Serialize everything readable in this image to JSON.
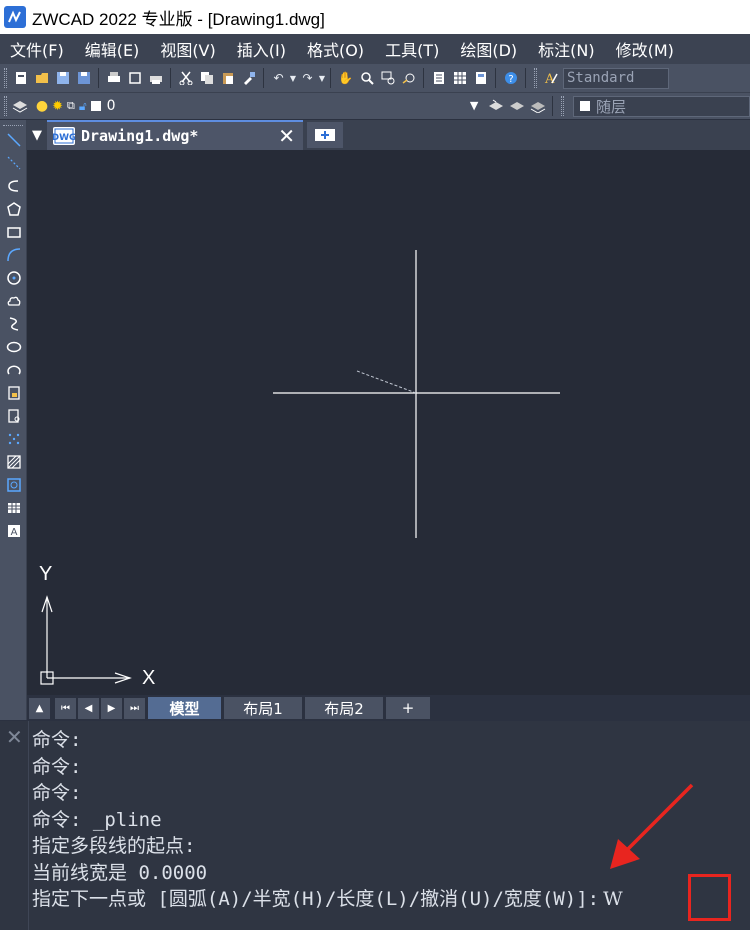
{
  "window": {
    "title": "ZWCAD 2022 专业版 - [Drawing1.dwg]"
  },
  "menu": [
    "文件(F)",
    "编辑(E)",
    "视图(V)",
    "插入(I)",
    "格式(O)",
    "工具(T)",
    "绘图(D)",
    "标注(N)",
    "修改(M)"
  ],
  "toolbar1": {
    "text_style": "Standard"
  },
  "toolbar2": {
    "layer": "0",
    "color": "随层"
  },
  "doc_tabs": {
    "active": "Drawing1.dwg*"
  },
  "layout_tabs": [
    "模型",
    "布局1",
    "布局2",
    "+"
  ],
  "canvas": {
    "axis_x": "X",
    "axis_y": "Y"
  },
  "command": {
    "history": [
      "命令:",
      "命令:",
      "命令:",
      "命令: _pline",
      "指定多段线的起点:",
      "当前线宽是 0.0000"
    ],
    "prompt": "指定下一点或 [圆弧(A)/半宽(H)/长度(L)/撤消(U)/宽度(W)]:",
    "input": "W"
  },
  "colors": {
    "menubar": "#3c4352",
    "toolbar": "#4a5263",
    "canvas": "#262b37",
    "highlight": "#e8251f",
    "accent": "#2d6fd6"
  }
}
